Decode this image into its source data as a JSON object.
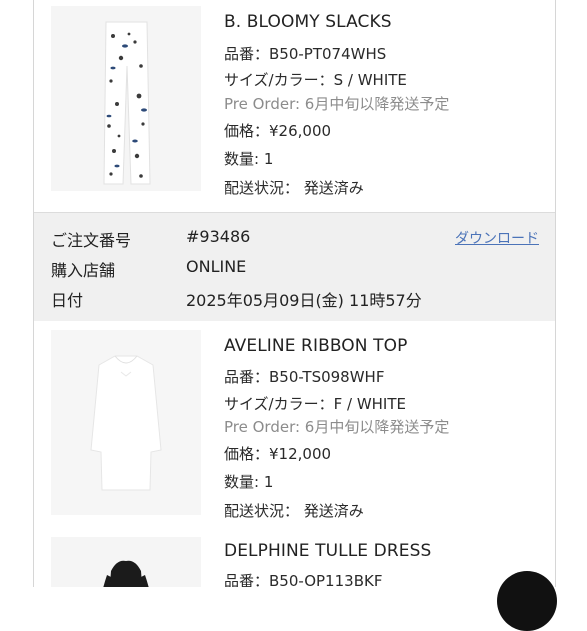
{
  "items": [
    {
      "name": "B. BLOOMY SLACKS",
      "sku": "品番：B50-PT074WHS",
      "size_color": "サイズ/カラー：S / WHITE",
      "pre_order": "Pre Order: 6月中旬以降発送予定",
      "price": "価格：¥26,000",
      "qty": "数量: 1",
      "shipping": "配送状況： 発送済み"
    },
    {
      "name": "AVELINE RIBBON TOP",
      "sku": "品番：B50-TS098WHF",
      "size_color": "サイズ/カラー：F / WHITE",
      "pre_order": "Pre Order: 6月中旬以降発送予定",
      "price": "価格：¥12,000",
      "qty": "数量: 1",
      "shipping": "配送状況： 発送済み"
    },
    {
      "name": "DELPHINE TULLE DRESS",
      "sku": "品番：B50-OP113BKF"
    }
  ],
  "order": {
    "number_label": "ご注文番号",
    "number_value": "#93486",
    "download_label": "ダウンロード",
    "store_label": "購入店舗",
    "store_value": "ONLINE",
    "date_label": "日付",
    "date_value": "2025年05月09日(金) 11時57分"
  },
  "colors": {
    "link": "#4b73b8",
    "pre_order_text": "#8c8c8c",
    "order_band": "#f0f0f0"
  },
  "icons": {
    "chat_button": "chat-bubble-icon"
  }
}
